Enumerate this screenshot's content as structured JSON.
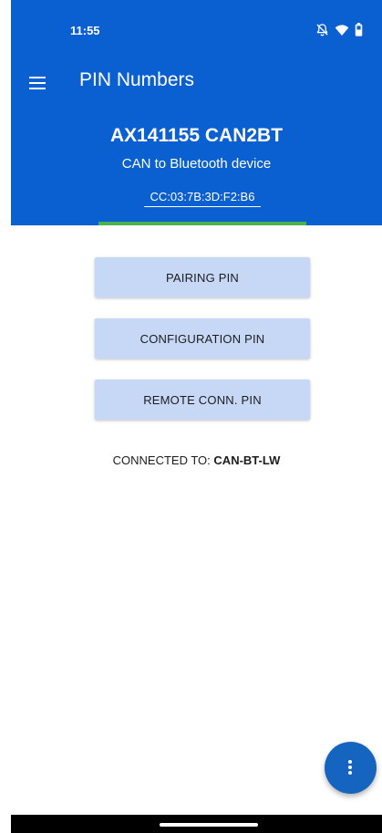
{
  "status_bar": {
    "time": "11:55",
    "icons": [
      "bell-muted-icon",
      "wifi-icon",
      "battery-icon"
    ]
  },
  "app_bar": {
    "menu_icon": "menu-icon",
    "title": "PIN Numbers"
  },
  "device": {
    "name": "AX141155 CAN2BT",
    "description": "CAN to Bluetooth device",
    "mac_address": "CC:03:7B:3D:F2:B6",
    "progress": 1.0
  },
  "buttons": {
    "pairing_label": "PAIRING PIN",
    "configuration_label": "CONFIGURATION PIN",
    "remote_label": "REMOTE CONN. PIN"
  },
  "connection": {
    "label": "CONNECTED TO:",
    "value": "CAN-BT-LW"
  },
  "fab": {
    "icon": "more-vert-icon"
  },
  "colors": {
    "primary": "#0a5fd1",
    "button_bg": "#c7d8f7",
    "progress": "#4caf50",
    "fab": "#1565c0"
  }
}
